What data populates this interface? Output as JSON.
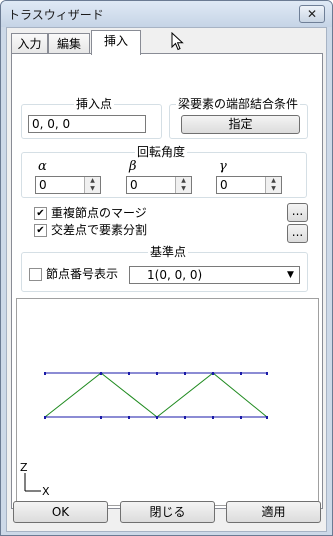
{
  "window": {
    "title": "トラスウィザード",
    "close_glyph": "✕"
  },
  "tabs": [
    {
      "label": "入力"
    },
    {
      "label": "編集"
    },
    {
      "label": "挿入",
      "active": true
    }
  ],
  "insert_point": {
    "group_label": "挿入点",
    "value": "0, 0, 0"
  },
  "beam_end": {
    "group_label": "梁要素の端部結合条件",
    "button_label": "指定"
  },
  "rotation": {
    "group_label": "回転角度",
    "fields": [
      {
        "symbol": "α",
        "value": "0"
      },
      {
        "symbol": "β",
        "value": "0"
      },
      {
        "symbol": "γ",
        "value": "0"
      }
    ]
  },
  "options": {
    "merge_nodes": {
      "label": "重複節点のマージ",
      "checked": true,
      "button_label": "..."
    },
    "split_at_intersection": {
      "label": "交差点で要素分割",
      "checked": true,
      "button_label": "..."
    }
  },
  "base_point": {
    "group_label": "基準点",
    "show_node_numbers": {
      "label": "節点番号表示",
      "checked": false
    },
    "selected": "1(0, 0, 0)"
  },
  "preview": {
    "axis_labels": {
      "vertical": "Z",
      "horizontal": "X"
    },
    "colors": {
      "chord": "#1a1aa8",
      "diagonal": "#1e8a1e",
      "node": "#1a1aa8"
    }
  },
  "buttons": {
    "ok": "OK",
    "close": "閉じる",
    "apply": "適用"
  }
}
